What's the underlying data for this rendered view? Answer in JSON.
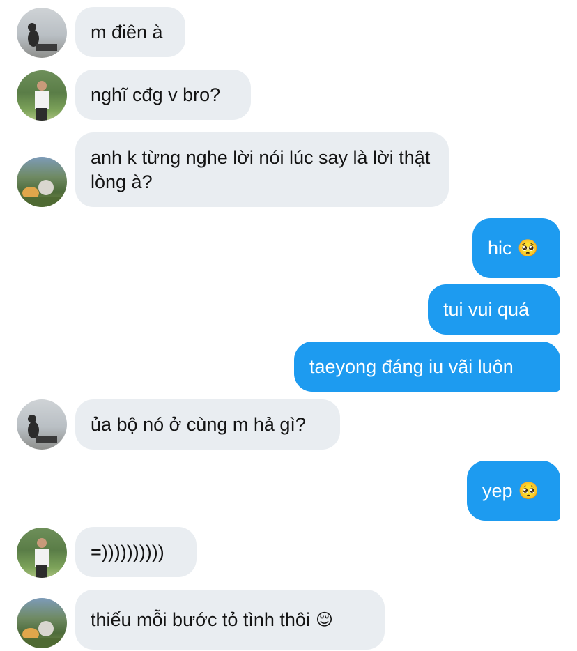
{
  "messages": [
    {
      "side": "in",
      "avatar": "avatar-silhouette",
      "text": "m điên à"
    },
    {
      "side": "in",
      "avatar": "avatar-person-white-shirt",
      "text": "nghĩ cđg v bro?"
    },
    {
      "side": "in",
      "avatar": "avatar-garden",
      "text": "anh k từng nghe lời nói lúc say là lời thật lòng à?"
    },
    {
      "side": "out",
      "text": "hic",
      "emoji": "🥺"
    },
    {
      "side": "out",
      "text": "tui vui quá"
    },
    {
      "side": "out",
      "text": "taeyong đáng iu vãi luôn"
    },
    {
      "side": "in",
      "avatar": "avatar-silhouette",
      "text": "ủa bộ nó ở cùng m hả gì?"
    },
    {
      "side": "out",
      "text": "yep",
      "emoji": "🥺"
    },
    {
      "side": "in",
      "avatar": "avatar-person-white-shirt",
      "text": "=))))))))))"
    },
    {
      "side": "in",
      "avatar": "avatar-garden",
      "text": "thiếu mỗi bước tỏ tình thôi",
      "emoji": "😌"
    }
  ],
  "colors": {
    "incoming_bg": "#e9edf1",
    "outgoing_bg": "#1d9bf0"
  }
}
